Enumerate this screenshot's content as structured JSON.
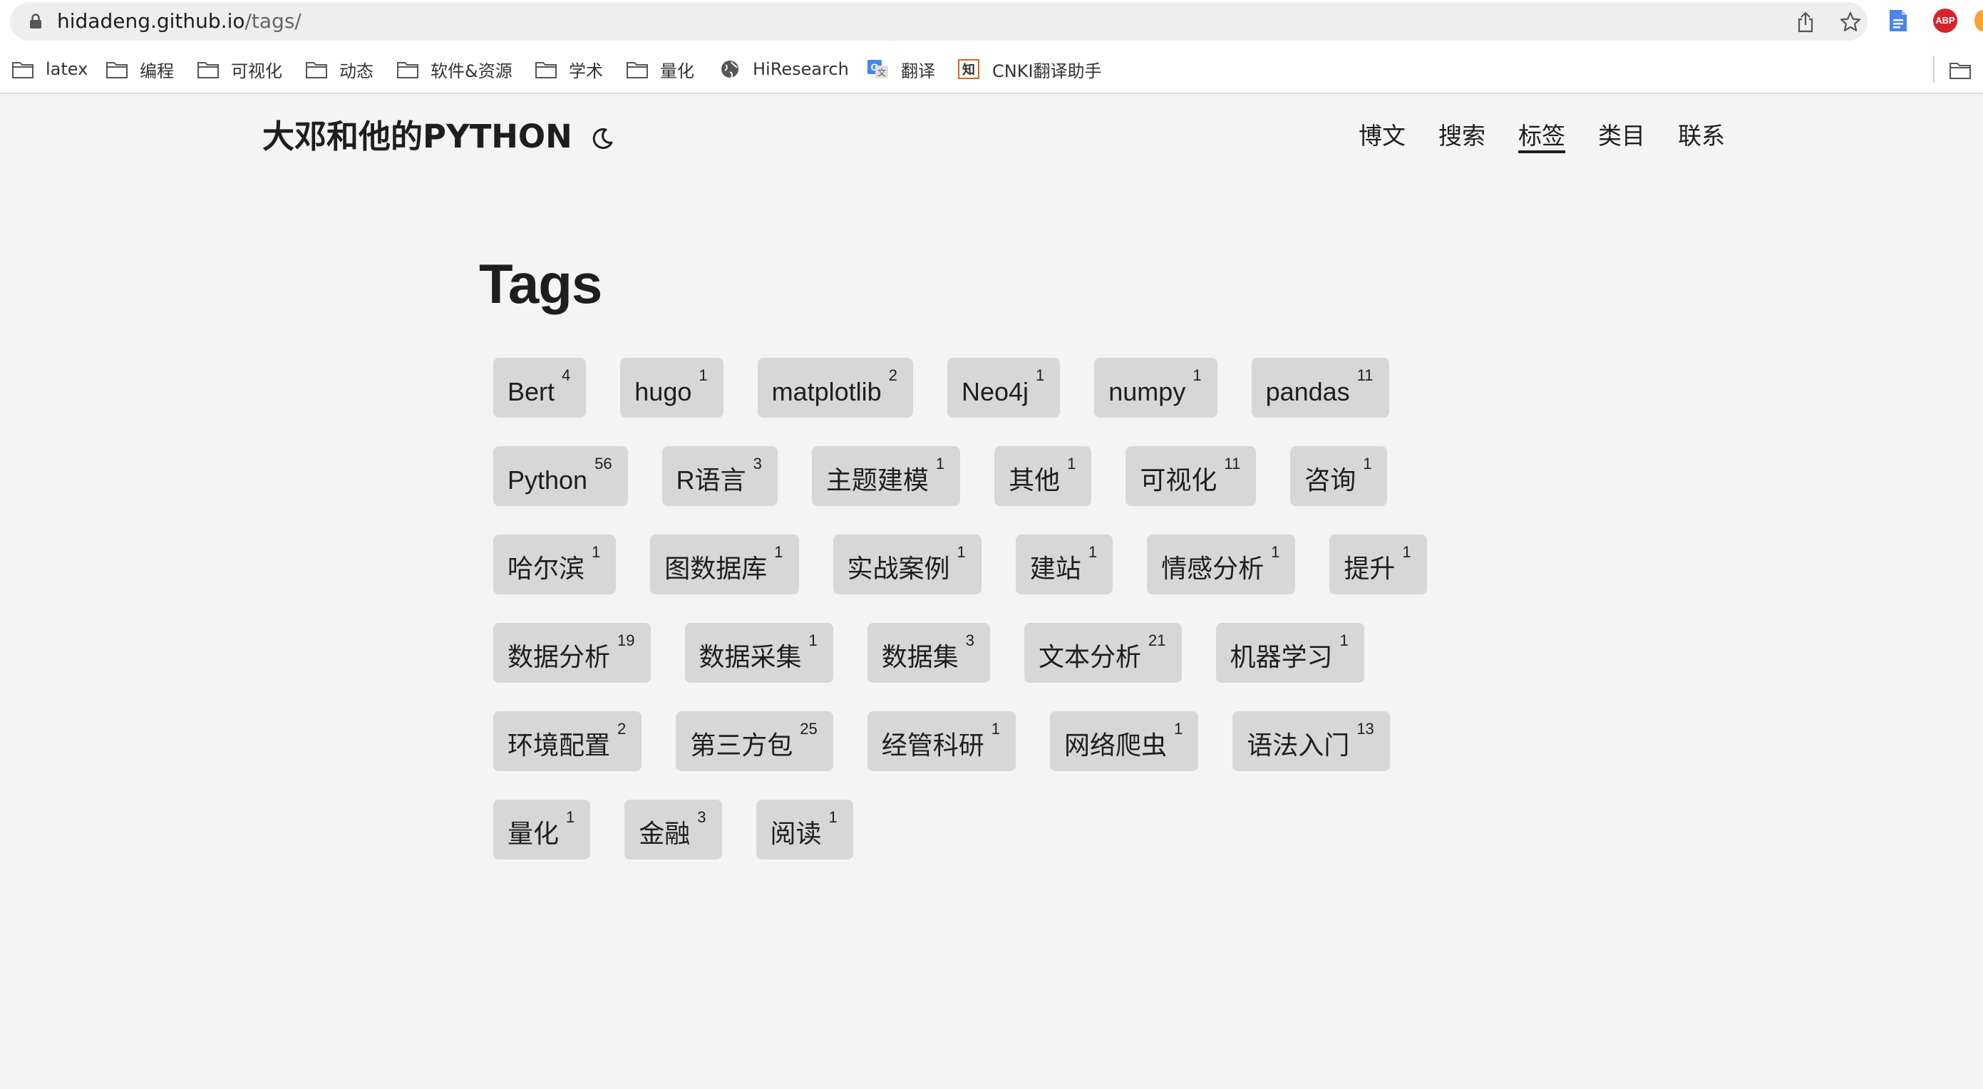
{
  "browser": {
    "url_host": "hidadeng.github.io",
    "url_path": "/tags/",
    "extension_badge": "ABP",
    "bookmarks": [
      {
        "label": "latex",
        "icon": "folder-icon"
      },
      {
        "label": "编程",
        "icon": "folder-icon"
      },
      {
        "label": "可视化",
        "icon": "folder-icon"
      },
      {
        "label": "动态",
        "icon": "folder-icon"
      },
      {
        "label": "软件&资源",
        "icon": "folder-icon"
      },
      {
        "label": "学术",
        "icon": "folder-icon"
      },
      {
        "label": "量化",
        "icon": "folder-icon"
      },
      {
        "label": "HiResearch",
        "icon": "globe-icon"
      },
      {
        "label": "翻译",
        "icon": "google-translate-icon"
      },
      {
        "label": "CNKI翻译助手",
        "icon": "cnki-icon"
      }
    ]
  },
  "site": {
    "title": "大邓和他的PYTHON",
    "nav": [
      {
        "label": "博文",
        "active": false
      },
      {
        "label": "搜索",
        "active": false
      },
      {
        "label": "标签",
        "active": true
      },
      {
        "label": "类目",
        "active": false
      },
      {
        "label": "联系",
        "active": false
      }
    ]
  },
  "page": {
    "heading": "Tags",
    "tags": [
      {
        "name": "Bert",
        "count": "4"
      },
      {
        "name": "hugo",
        "count": "1"
      },
      {
        "name": "matplotlib",
        "count": "2"
      },
      {
        "name": "Neo4j",
        "count": "1"
      },
      {
        "name": "numpy",
        "count": "1"
      },
      {
        "name": "pandas",
        "count": "11"
      },
      {
        "name": "Python",
        "count": "56"
      },
      {
        "name": "R语言",
        "count": "3"
      },
      {
        "name": "主题建模",
        "count": "1"
      },
      {
        "name": "其他",
        "count": "1"
      },
      {
        "name": "可视化",
        "count": "11"
      },
      {
        "name": "咨询",
        "count": "1"
      },
      {
        "name": "哈尔滨",
        "count": "1"
      },
      {
        "name": "图数据库",
        "count": "1"
      },
      {
        "name": "实战案例",
        "count": "1"
      },
      {
        "name": "建站",
        "count": "1"
      },
      {
        "name": "情感分析",
        "count": "1"
      },
      {
        "name": "提升",
        "count": "1"
      },
      {
        "name": "数据分析",
        "count": "19"
      },
      {
        "name": "数据采集",
        "count": "1"
      },
      {
        "name": "数据集",
        "count": "3"
      },
      {
        "name": "文本分析",
        "count": "21"
      },
      {
        "name": "机器学习",
        "count": "1"
      },
      {
        "name": "环境配置",
        "count": "2"
      },
      {
        "name": "第三方包",
        "count": "25"
      },
      {
        "name": "经管科研",
        "count": "1"
      },
      {
        "name": "网络爬虫",
        "count": "1"
      },
      {
        "name": "语法入门",
        "count": "13"
      },
      {
        "name": "量化",
        "count": "1"
      },
      {
        "name": "金融",
        "count": "3"
      },
      {
        "name": "阅读",
        "count": "1"
      }
    ]
  }
}
